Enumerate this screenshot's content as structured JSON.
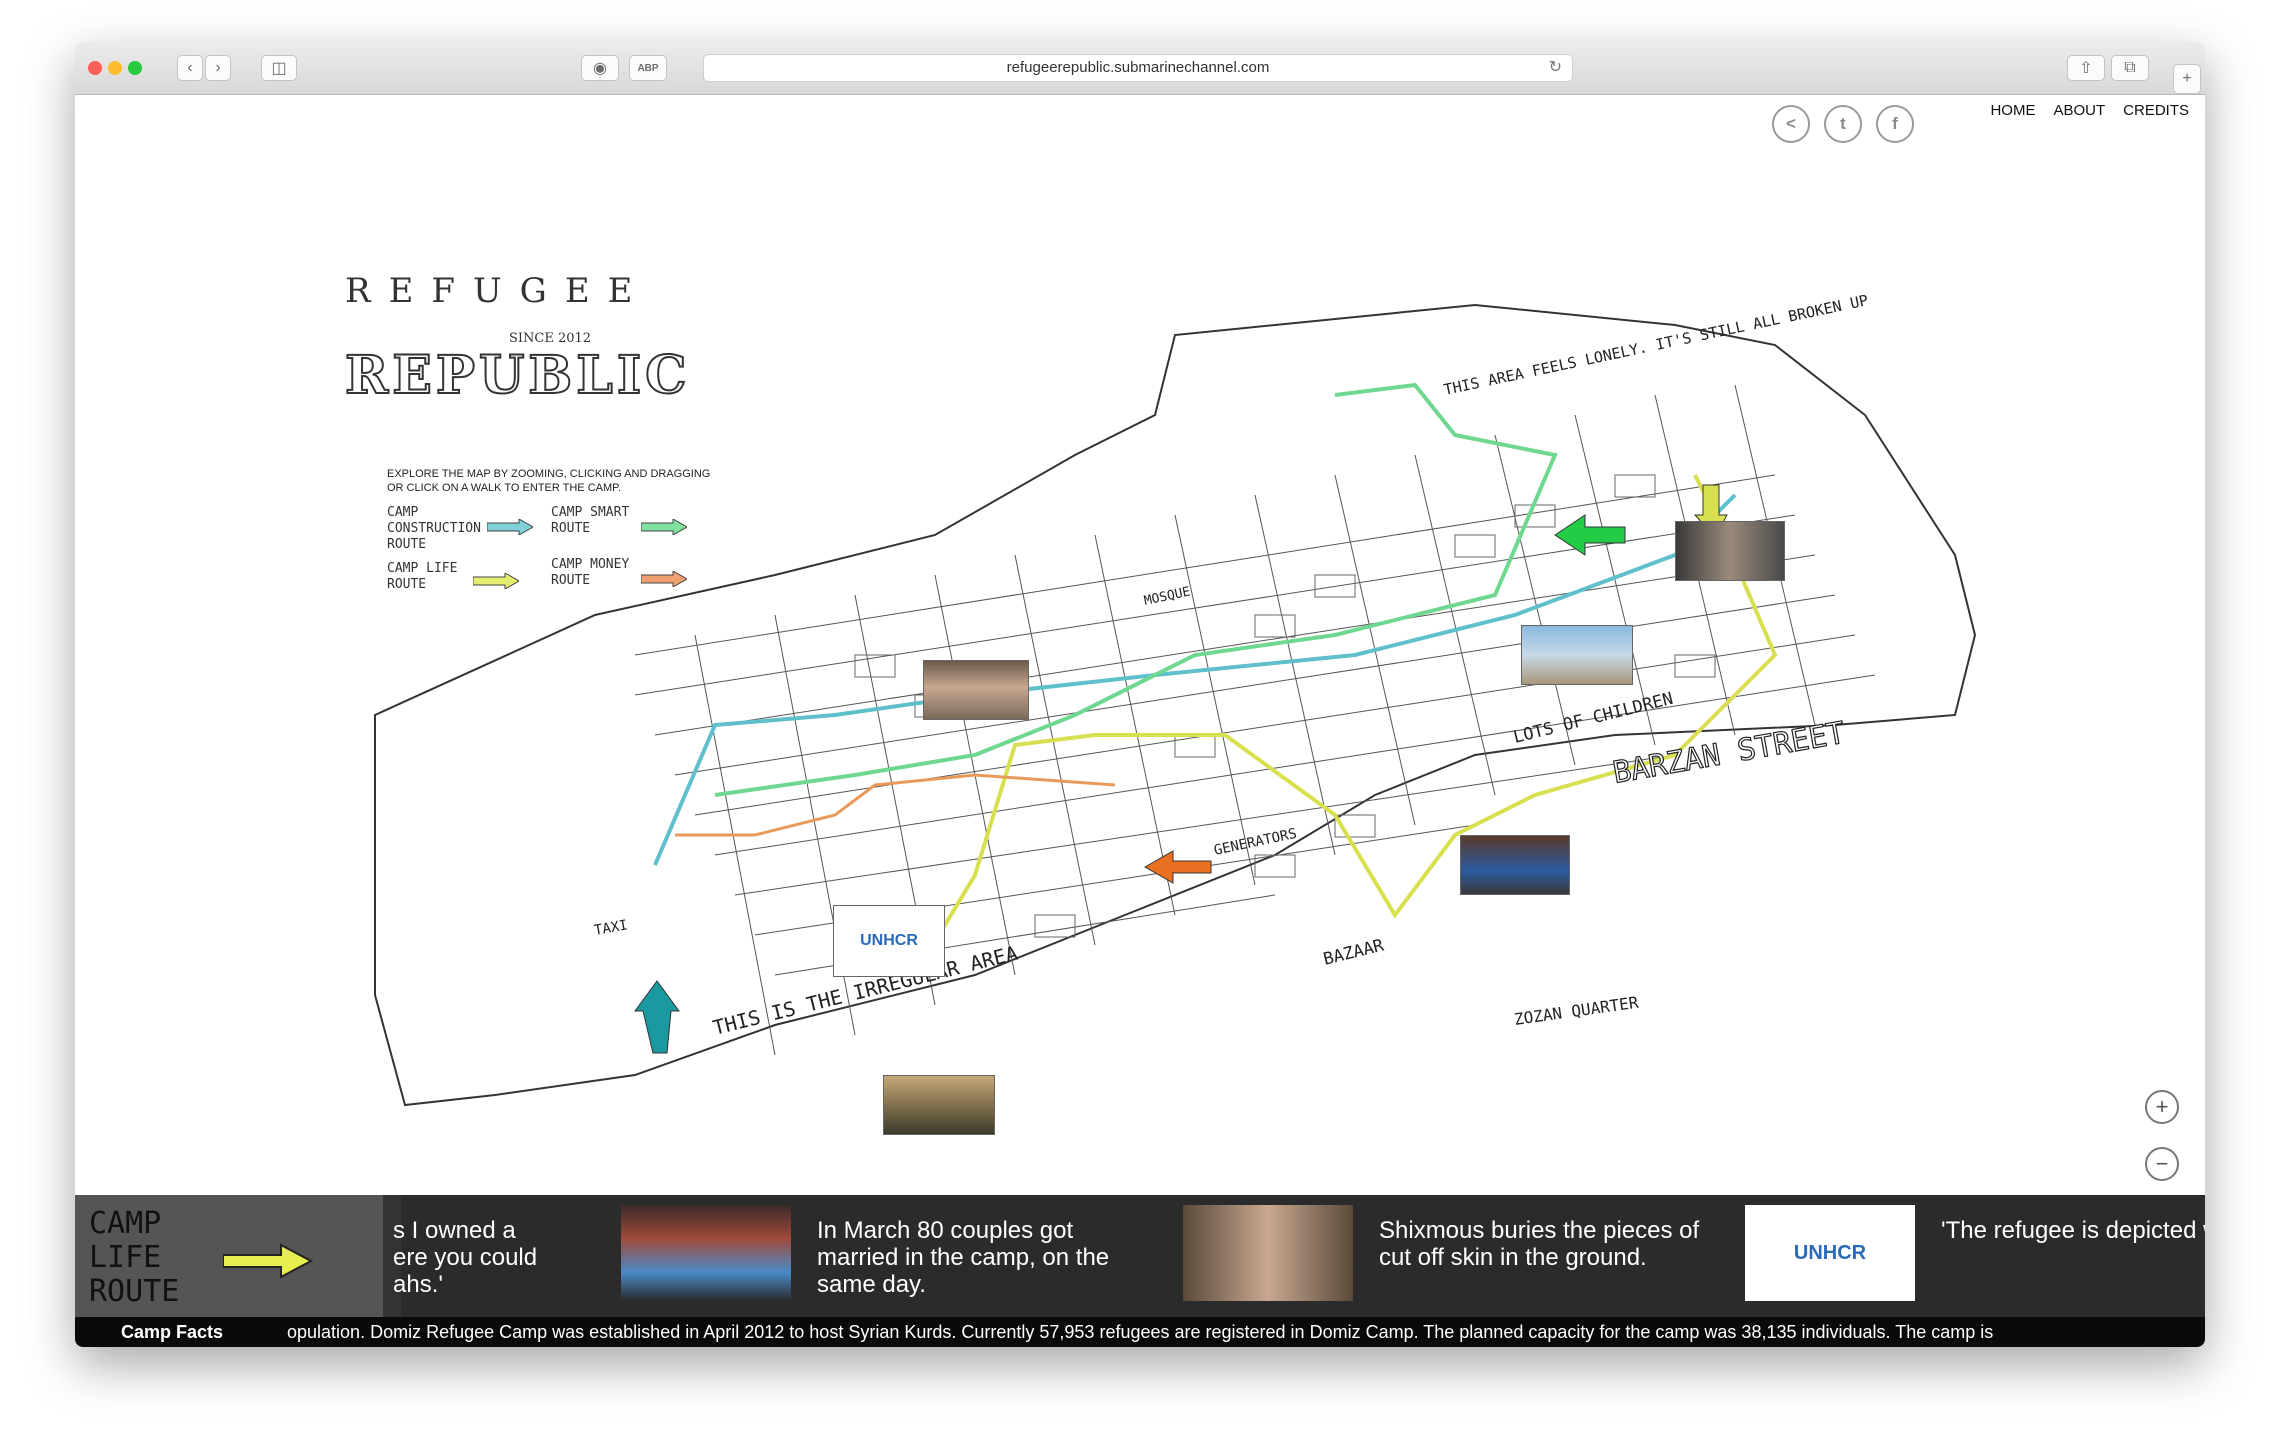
{
  "browser": {
    "url": "refugeerepublic.submarinechannel.com"
  },
  "nav": {
    "items": [
      "HOME",
      "ABOUT",
      "CREDITS"
    ]
  },
  "logo": {
    "top": "REFUGEE",
    "since": "SINCE 2012",
    "main": "REPUBLIC"
  },
  "intro": {
    "text": "EXPLORE THE MAP BY ZOOMING, CLICKING AND DRAGGING OR CLICK ON A WALK TO ENTER THE CAMP."
  },
  "routes": [
    {
      "label": "CAMP CONSTRUCTION ROUTE",
      "color": "#7fd0d8"
    },
    {
      "label": "CAMP SMART ROUTE",
      "color": "#7fe0a0"
    },
    {
      "label": "CAMP LIFE ROUTE",
      "color": "#e6ee70"
    },
    {
      "label": "CAMP MONEY ROUTE",
      "color": "#f0a070"
    }
  ],
  "map_labels": {
    "barzan": "BARZAN STREET",
    "this_area": "THIS AREA FEELS LONELY. IT'S STILL ALL BROKEN UP",
    "irregular": "THIS IS THE IRREGULAR AREA",
    "children": "LOTS OF CHILDREN",
    "bazaar": "BAZAAR",
    "zozan": "ZOZAN QUARTER",
    "generators": "GENERATORS",
    "mosque": "MOSQUE",
    "taxi": "TAXI",
    "unhcr": "UNHCR"
  },
  "strip": {
    "route_badge": "CAMP LIFE ROUTE",
    "cards": [
      {
        "text": "s I owned a ere you could ahs.'"
      },
      {
        "text": "In March 80 couples got married in the camp, on the same day."
      },
      {
        "text": "Shixmous buries the pieces of cut off skin in the ground."
      },
      {
        "text": "'The refugee is depicted without arms or legs.'"
      }
    ]
  },
  "facts": {
    "title": "Camp Facts",
    "text": "opulation.   Domiz Refugee Camp was established in April 2012 to host Syrian Kurds.   Currently 57,953 refugees are registered in Domiz Camp. The planned capacity for the camp was 38,135 individuals.   The camp is"
  },
  "colors": {
    "construction": "#5fc0cc",
    "smart": "#6fd890",
    "life": "#d8e050",
    "money": "#e89a5a",
    "green_arrow": "#22cc44",
    "teal_arrow": "#1a9aa0",
    "orange_arrow": "#e87020"
  }
}
